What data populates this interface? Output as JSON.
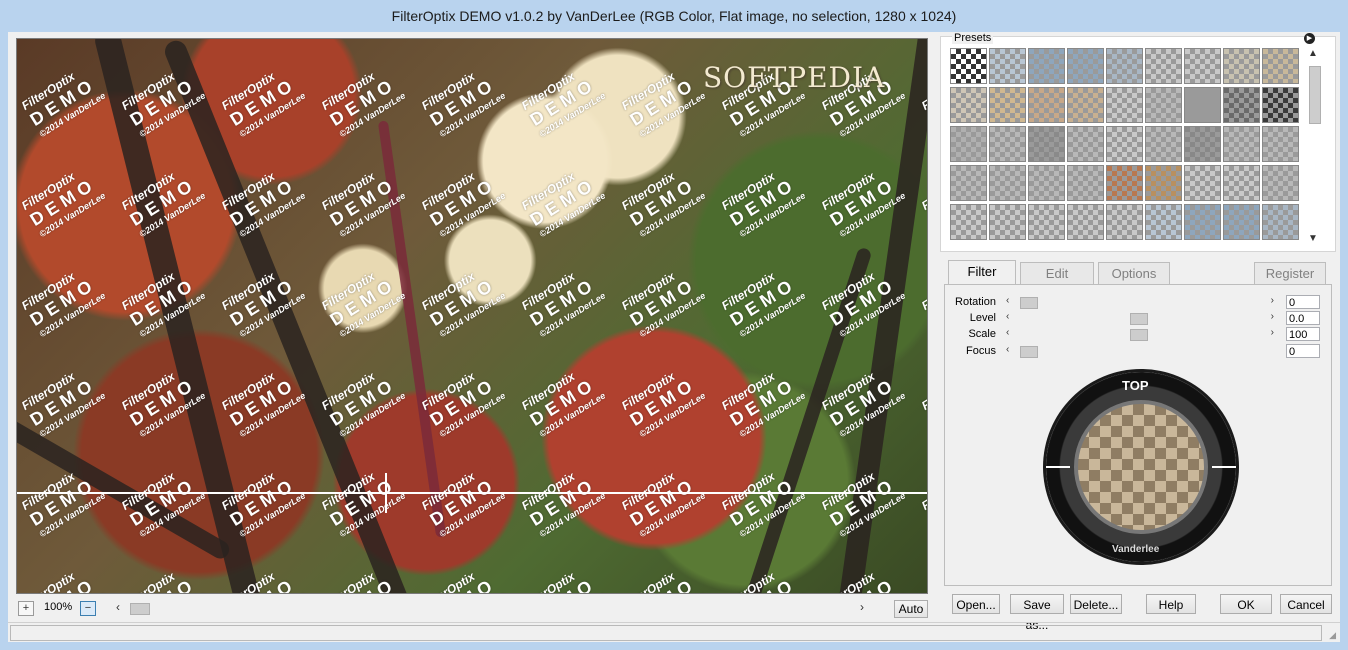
{
  "window": {
    "title": "FilterOptix DEMO v1.0.2 by VanDerLee (RGB Color, Flat image, no selection, 1280 x 1024)"
  },
  "preview": {
    "watermark_brand": "FilterOptix",
    "watermark_word": "DEMO",
    "watermark_copyright": "©2014 VanDerLee",
    "overlay_logo": "SOFTPEDIA"
  },
  "zoom": {
    "plus": "+",
    "level": "100%",
    "minus": "−"
  },
  "buttons": {
    "auto": "Auto",
    "open": "Open...",
    "save_as": "Save as...",
    "delete": "Delete...",
    "help": "Help",
    "ok": "OK",
    "cancel": "Cancel"
  },
  "presets": {
    "label": "Presets"
  },
  "tabs": [
    {
      "label": "Filter"
    },
    {
      "label": "Edit"
    },
    {
      "label": "Options"
    },
    {
      "label": "Register"
    }
  ],
  "params": [
    {
      "label": "Rotation",
      "value": "0",
      "level": 0.0
    },
    {
      "label": "Level",
      "value": "0.0",
      "level": 0.5
    },
    {
      "label": "Scale",
      "value": "100",
      "level": 0.5
    },
    {
      "label": "Focus",
      "value": "0",
      "level": 0.0
    }
  ],
  "filter_ring": {
    "top_label": "TOP",
    "brand": "Vanderlee"
  }
}
